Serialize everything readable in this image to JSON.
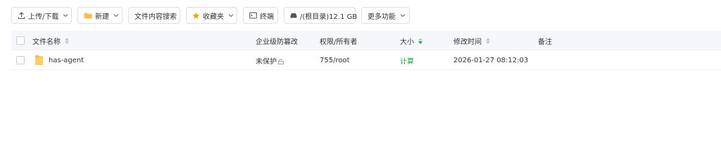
{
  "toolbar": {
    "upload_download": "上传/下载",
    "new": "新建",
    "content_search": "文件内容搜索",
    "favorites": "收藏夹",
    "terminal": "终端",
    "disk": "/(根目录)12.1 GB",
    "more": "更多功能"
  },
  "table": {
    "columns": {
      "name": "文件名称",
      "protection": "企业级防篡改",
      "permission": "权限/所有者",
      "size": "大小",
      "modified": "修改时间",
      "note": "备注"
    },
    "rows": [
      {
        "name": "has-agent",
        "protection": "未保护",
        "permission": "755/root",
        "size": "计算",
        "modified": "2026-01-27 08:12:03",
        "note": ""
      }
    ]
  },
  "colors": {
    "accent": "#20a53a",
    "folder": "#f5c04a",
    "star": "#f0a020"
  },
  "icons": [
    "upload-icon",
    "folder-icon",
    "star-icon",
    "terminal-icon",
    "disk-icon",
    "chevron-down-icon",
    "lock-icon"
  ]
}
